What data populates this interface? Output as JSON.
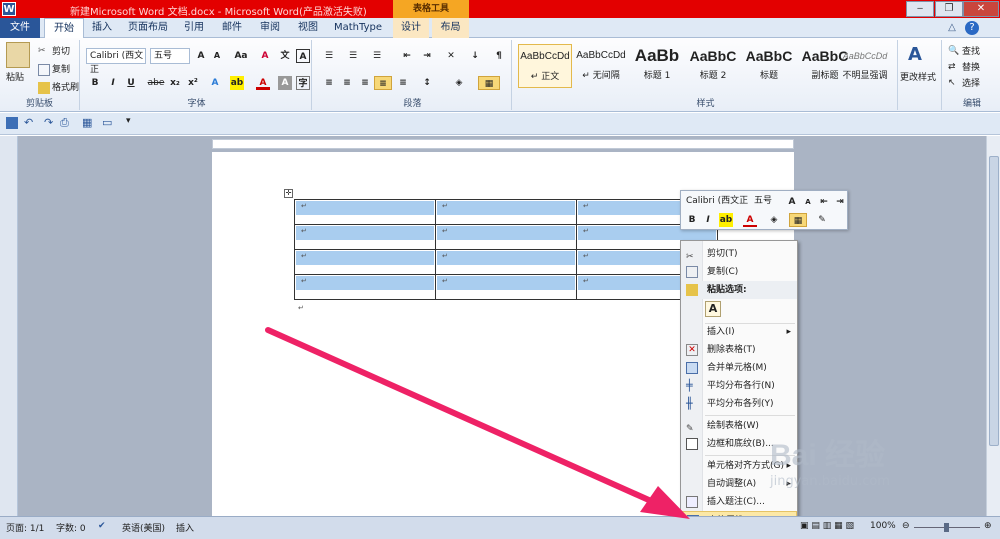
{
  "titlebar": {
    "app_icon": "W",
    "title": "新建Microsoft Word 文档.docx - Microsoft Word(产品激活失败)",
    "context_group": "表格工具",
    "minimize": "‒",
    "restore": "❐",
    "close": "✕"
  },
  "tabs": {
    "file": "文件",
    "items": [
      "开始",
      "插入",
      "页面布局",
      "引用",
      "邮件",
      "审阅",
      "视图",
      "MathType",
      "设计",
      "布局"
    ]
  },
  "ribbon": {
    "clipboard": {
      "paste": "粘贴",
      "cut": "剪切",
      "copy": "复制",
      "format_painter": "格式刷",
      "label": "剪贴板"
    },
    "font": {
      "font_name": "Calibri (西文正",
      "font_size": "五号",
      "grow": "A",
      "shrink": "A",
      "case": "Aa",
      "clear": "A",
      "label": "字体",
      "bold": "B",
      "italic": "I",
      "underline": "U",
      "strike": "abe",
      "sub": "x₂",
      "sup": "x²",
      "phonetic": "文",
      "char_border": "A"
    },
    "paragraph": {
      "label": "段落"
    },
    "styles": {
      "label": "样式",
      "items": [
        {
          "sample": "AaBbCcDd",
          "name": "↵ 正文"
        },
        {
          "sample": "AaBbCcDd",
          "name": "↵ 无间隔"
        },
        {
          "sample": "AaBb",
          "name": "标题 1"
        },
        {
          "sample": "AaBbC",
          "name": "标题 2"
        },
        {
          "sample": "AaBbC",
          "name": "标题"
        },
        {
          "sample": "AaBbC",
          "name": "副标题"
        },
        {
          "sample": "AaBbCcDd",
          "name": "不明显强调"
        }
      ],
      "change_styles": "更改样式"
    },
    "editing": {
      "find": "查找",
      "replace": "替换",
      "select": "选择",
      "label": "编辑"
    }
  },
  "minitoolbar": {
    "font_name": "Calibri (西文正",
    "font_size": "五号",
    "bold": "B",
    "italic": "I"
  },
  "context_menu": {
    "items": [
      {
        "label": "剪切(T)",
        "icon": "scissors-icon"
      },
      {
        "label": "复制(C)",
        "icon": "copy-icon"
      },
      {
        "label": "粘贴选项:",
        "icon": "paste-icon"
      },
      {
        "label": "插入(I)",
        "icon": "",
        "submenu": "▸"
      },
      {
        "label": "删除表格(T)",
        "icon": "delete-table-icon"
      },
      {
        "label": "合并单元格(M)",
        "icon": "merge-cells-icon"
      },
      {
        "label": "平均分布各行(N)",
        "icon": "distribute-rows-icon"
      },
      {
        "label": "平均分布各列(Y)",
        "icon": "distribute-columns-icon"
      },
      {
        "label": "绘制表格(W)",
        "icon": "draw-table-icon"
      },
      {
        "label": "边框和底纹(B)...",
        "icon": "borders-icon"
      },
      {
        "label": "单元格对齐方式(G)",
        "icon": "",
        "submenu": "▸"
      },
      {
        "label": "自动调整(A)",
        "icon": "",
        "submenu": "▸"
      },
      {
        "label": "插入题注(C)...",
        "icon": "caption-icon"
      },
      {
        "label": "表格属性(R)...",
        "icon": "table-properties-icon"
      }
    ],
    "paste_option": "A"
  },
  "document": {
    "paragraph_mark": "↵",
    "rows": 4,
    "cols": 3
  },
  "statusbar": {
    "page": "页面: 1/1",
    "words": "字数: 0",
    "language": "英语(美国)",
    "mode": "插入",
    "zoom": "100%"
  },
  "watermark": {
    "text": "Bai 经验",
    "url": "jingyan.baidu.com"
  },
  "colors": {
    "title_red": "#e30000",
    "context_orange": "#f5a623",
    "arrow": "#ee2266",
    "highlight": "#a9cdef"
  }
}
